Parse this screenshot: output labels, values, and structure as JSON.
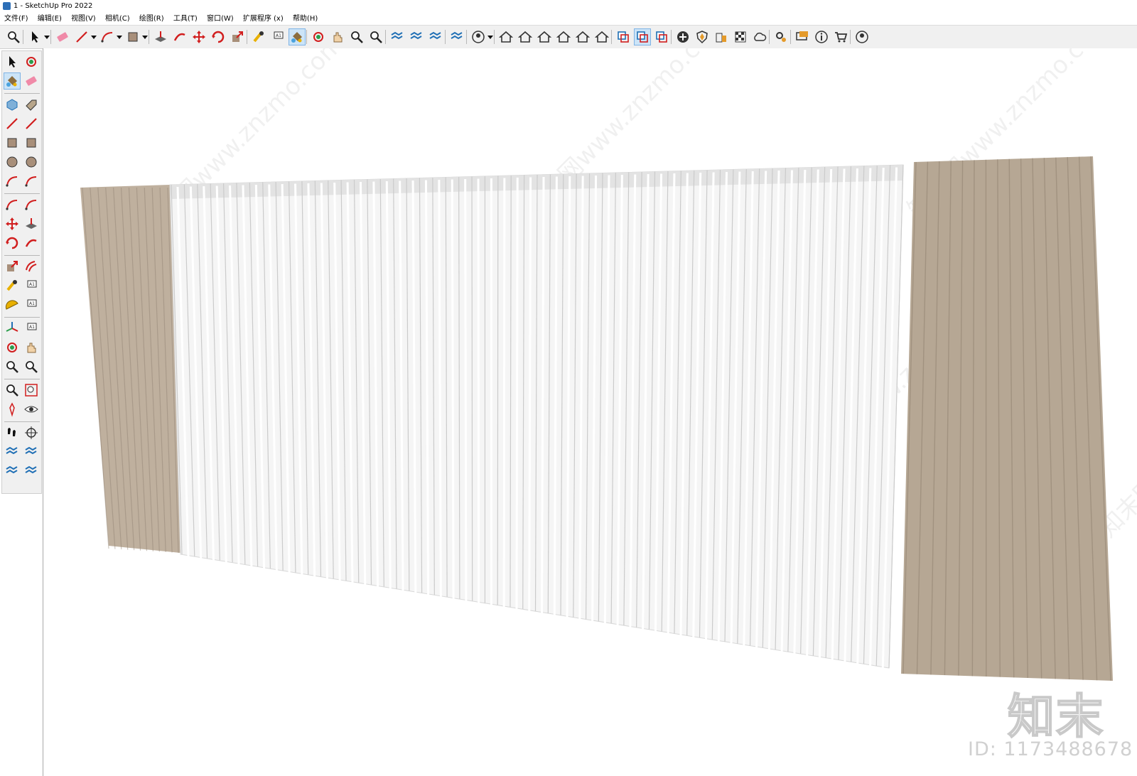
{
  "window": {
    "title": "1 - SketchUp Pro 2022"
  },
  "menu": [
    "文件(F)",
    "编辑(E)",
    "视图(V)",
    "相机(C)",
    "绘图(R)",
    "工具(T)",
    "窗口(W)",
    "扩展程序 (x)",
    "帮助(H)"
  ],
  "toolbar": {
    "icons": [
      "zoom-window",
      "select-dropdown",
      "eraser",
      "line-pencil-dropdown",
      "arc-dropdown",
      "rectangle-dropdown",
      "push-pull",
      "follow-me",
      "move",
      "rotate",
      "scale",
      "tape-measure",
      "text-label",
      "paint-bucket",
      "orbit",
      "pan",
      "zoom",
      "zoom-extents",
      "sandbox-1",
      "sandbox-2",
      "sandbox-3",
      "sandbox-4",
      "account-dropdown",
      "warehouse-1",
      "warehouse-2",
      "warehouse-3",
      "warehouse-4",
      "warehouse-5",
      "warehouse-6",
      "solid-tools-1",
      "solid-tools-2",
      "solid-tools-3",
      "add",
      "shield",
      "building",
      "checkerboard",
      "cloud",
      "extension-manager",
      "chat",
      "info",
      "cart",
      "profile"
    ],
    "active_icons": [
      "paint-bucket",
      "solid-tools-2"
    ]
  },
  "left_toolbar": {
    "icons": [
      "select",
      "orbit-cursor",
      "paint-bucket",
      "eraser",
      "component",
      "tag",
      "line",
      "freehand",
      "rectangle",
      "rotated-rectangle",
      "circle",
      "polygon",
      "arc",
      "arc-2point",
      "pie",
      "arc-3point",
      "move",
      "push-pull",
      "rotate",
      "follow-me",
      "scale",
      "offset",
      "tape-measure",
      "dimension",
      "protractor",
      "text-label",
      "axes",
      "3d-text",
      "orbit",
      "pan",
      "zoom",
      "zoom-window",
      "zoom-extents",
      "previous-view",
      "position-camera",
      "look-around",
      "walk",
      "section-plane",
      "sandbox-contours",
      "sandbox-scratch",
      "stamp",
      "drape"
    ],
    "active_icons": [
      "paint-bucket"
    ]
  },
  "viewport": {
    "model": "curtains",
    "watermark_text": "知末网www.znzmo.com",
    "colors": {
      "drape": "#bfb09e",
      "drape_dark": "#8f8170",
      "sheer": "#f5f5f5",
      "sheer_line": "#cbcbcb"
    }
  },
  "brand": {
    "logo": "知末",
    "id_text": "ID: 1173488678"
  }
}
